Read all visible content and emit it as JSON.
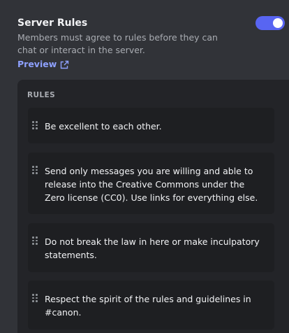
{
  "server_rules": {
    "title": "Server Rules",
    "description": "Members must agree to rules before they can chat or interact in the server.",
    "preview_label": "Preview",
    "enabled": true
  },
  "rules_panel": {
    "label": "RULES",
    "rules": [
      {
        "text": "Be excellent to each other."
      },
      {
        "text": "Send only messages you are willing and able to release into the Creative Commons under the Zero license (CC0). Use links for everything else."
      },
      {
        "text": "Do not break the law in here or make inculpatory statements."
      },
      {
        "text": "Respect the spirit of the rules and guidelines in #canon."
      }
    ]
  },
  "colors": {
    "accent": "#5865f2",
    "link": "#8ea1ff",
    "panel_bg": "#232428",
    "rule_bg": "#1e1f22"
  },
  "icons": {
    "preview": "external-link-icon",
    "rule_handle": "drag-handle-icon"
  }
}
